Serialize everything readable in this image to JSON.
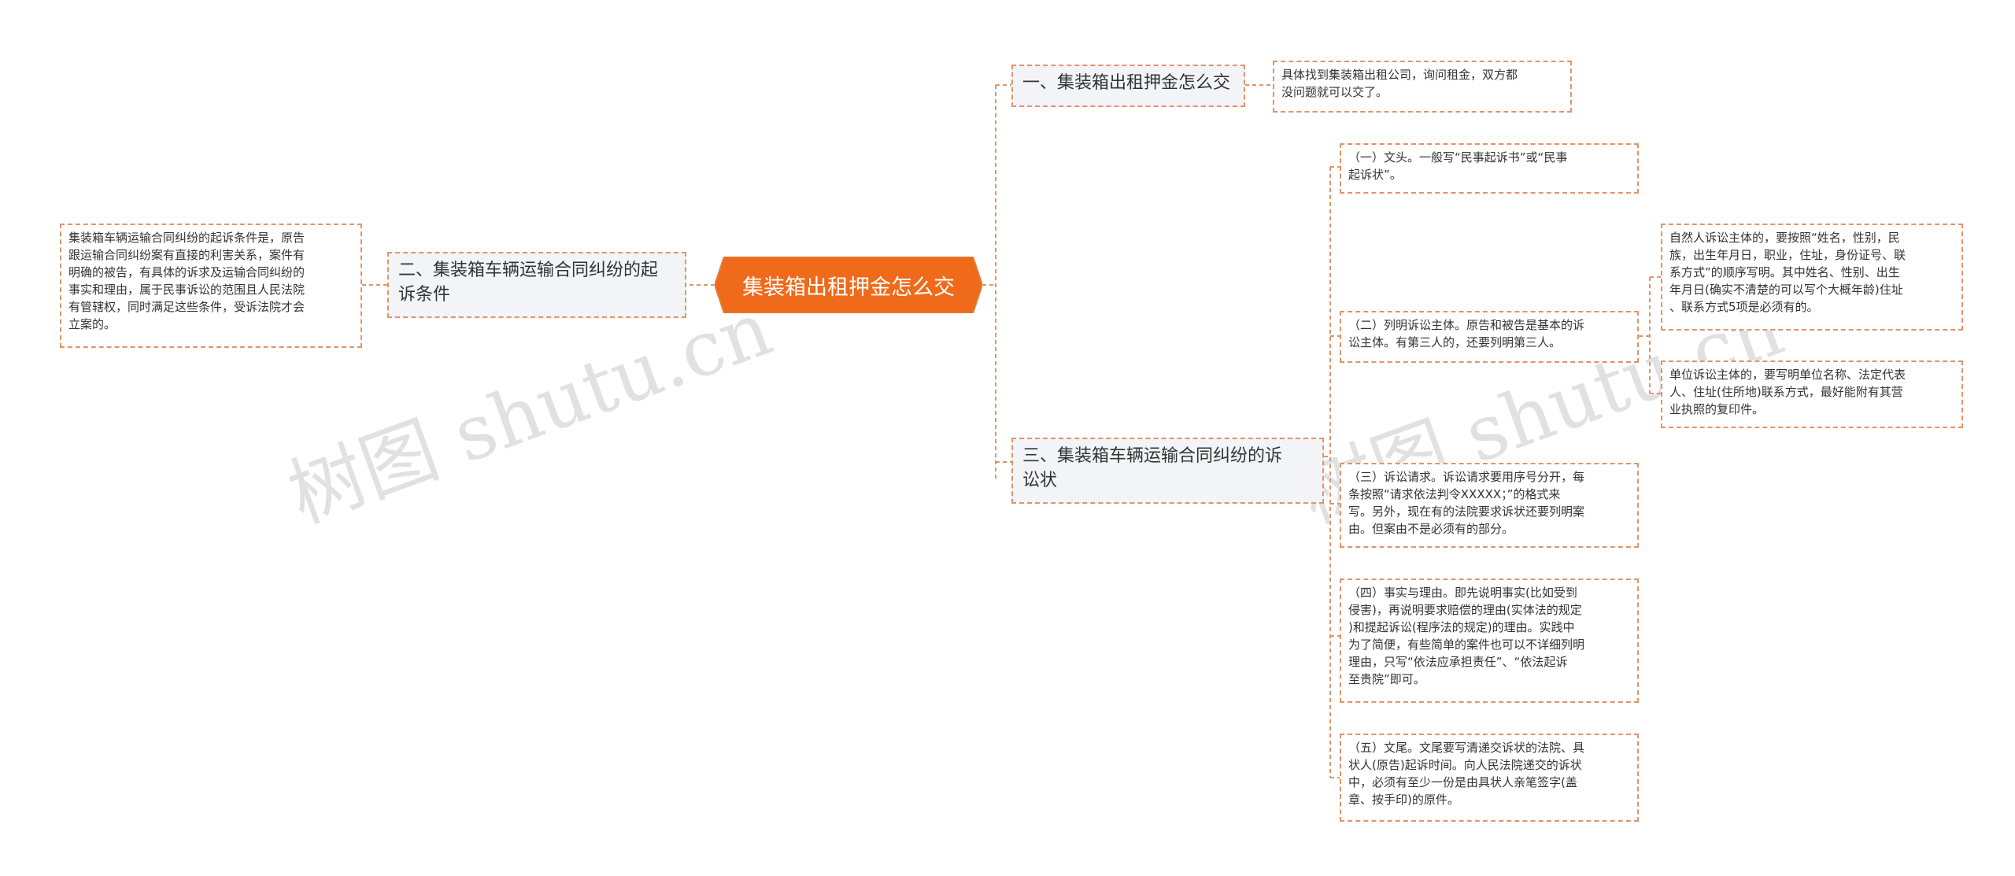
{
  "root": {
    "label": "集装箱出租押金怎么交",
    "color": "#ef6a1a"
  },
  "branches": {
    "b1": {
      "label": "一、集装箱出租押金怎么交"
    },
    "b2": {
      "label": "二、集装箱车辆运输合同纠纷的起\n诉条件"
    },
    "b3": {
      "label": "三、集装箱车辆运输合同纠纷的诉\n讼状"
    }
  },
  "leaves": {
    "b1_detail": "具体找到集装箱出租公司，询问租金，双方都\n没问题就可以交了。",
    "b2_detail": "集装箱车辆运输合同纠纷的起诉条件是，原告\n跟运输合同纠纷案有直接的利害关系，案件有\n明确的被告，有具体的诉求及运输合同纠纷的\n事实和理由，属于民事诉讼的范围且人民法院\n有管辖权，同时满足这些条件，受诉法院才会\n立案的。",
    "b3_1": "（一）文头。一般写“民事起诉书”或“民事\n起诉状”。",
    "b3_2": "（二）列明诉讼主体。原告和被告是基本的诉\n讼主体。有第三人的，还要列明第三人。",
    "b3_2_a": "自然人诉讼主体的，要按照“姓名，性别，民\n族，出生年月日，职业，住址，身份证号、联\n系方式”的顺序写明。其中姓名、性别、出生\n年月日(确实不清楚的可以写个大概年龄)住址\n、联系方式5项是必须有的。",
    "b3_2_b": "单位诉讼主体的，要写明单位名称、法定代表\n人、住址(住所地)联系方式，最好能附有其营\n业执照的复印件。",
    "b3_3": "（三）诉讼请求。诉讼请求要用序号分开，每\n条按照“请求依法判令XXXXX；”的格式来\n写。另外，现在有的法院要求诉状还要列明案\n由。但案由不是必须有的部分。",
    "b3_4": "（四）事实与理由。即先说明事实(比如受到\n侵害)，再说明要求赔偿的理由(实体法的规定\n)和提起诉讼(程序法的规定)的理由。实践中\n为了简便，有些简单的案件也可以不详细列明\n理由，只写“依法应承担责任”、“依法起诉\n至贵院”即可。",
    "b3_5": "（五）文尾。文尾要写清递交诉状的法院、具\n状人(原告)起诉时间。向人民法院递交的诉状\n中，必须有至少一份是由具状人亲笔签字(盖\n章、按手印)的原件。"
  },
  "watermarks": [
    "树图 shutu.cn",
    "树图 shutu.cn"
  ],
  "colors": {
    "connector": "#e0946a",
    "node_border": "#e0946a",
    "branch_fill": "#f2f4f7",
    "text": "#333333"
  }
}
